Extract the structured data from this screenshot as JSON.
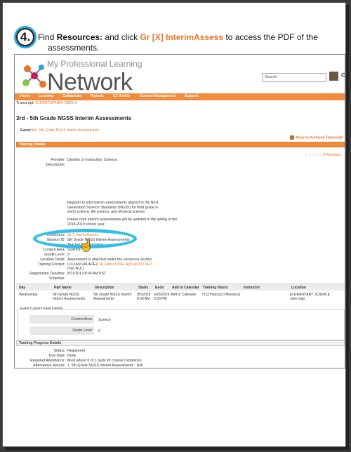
{
  "step": {
    "number": "4.",
    "text_before": "Find ",
    "resources_label": "Resources:",
    "text_middle": " and click ",
    "link_label": "Gr [X] InterimAssess",
    "text_after": " to access the PDF of the",
    "text_line2": "assessments."
  },
  "header": {
    "logo_small": "My Professional Learning",
    "logo_big": "Network",
    "search_placeholder": "Search",
    "colors": {
      "accent": "#f08c3c",
      "link": "#e8742a",
      "callout": "#2ec0e8",
      "step_ring": "#2aa6d6"
    }
  },
  "nav": [
    "Home",
    "Learning",
    "Collaborate",
    "Reports",
    "ILT Admin",
    "Content Management",
    "Support"
  ],
  "transcript": {
    "label": "Transcript:",
    "name": "CHRISTOPHER SIMS",
    "sep": ">"
  },
  "page_title": "3rd - 5th Grade NGSS Interim Assessments",
  "event": {
    "label": "Event:",
    "value": "3rd - 5th Grade NGSS Interim Assessments"
  },
  "archive_label": "Move to Archived Transcript",
  "training_details": {
    "header": "Training Details",
    "reviews": "0 Reviews",
    "stars": "☆☆☆☆☆",
    "provider_label": "Provider:",
    "provider_value": "Division of Instruction: Science",
    "description_label": "Description:",
    "desc1": "Register to pilot interim assessments aligned to the Next Generation Science Standards (NGSS) for third grade in earth science, life science, and physical science.",
    "desc2": "Please note interim assessments will be updated in the spring of the 2018-2019 school year.",
    "resources_label": "Resources:",
    "resources_value": "Gr 3 InterimAssess",
    "session_label": "Session ID:",
    "session_value": "5th Grade NGSS Interim Assessments",
    "teacher_value": "Teacher Development",
    "content_label": "Content Area:",
    "content_value": "Science",
    "grade_label": "Grade Level:",
    "grade_value": "3",
    "location_label": "Location Detail:",
    "location_value": "Assessment is attached under the resources section.",
    "contact_label": "Training Contact:",
    "contact_name": "LILLIAN VALADEZ",
    "contact_email": "LILLIAN.RODELA@LAUSD.NET",
    "contact_tel": "(Tel) NULL",
    "deadline_label": "Registration Deadline:",
    "deadline_value": "8/21/2019 8:00 AM PST",
    "schedule_label": "Schedule:"
  },
  "schedule_table": {
    "headers": [
      "Day",
      "Part Name",
      "Description",
      "Starts",
      "Ends",
      "Add to Calendar",
      "Training Hours",
      "Instructor",
      "Location"
    ],
    "row": {
      "day": "Wednesday",
      "part_name": "5th Grade NGSS Interim Assessments",
      "description": "5th Grade NGSS Interim Assessments",
      "starts": "9/5/2018 8:00 AM",
      "ends": "6/28/2019 5:00 PM",
      "add_to_calendar": "Add to Calendar",
      "training_hours": "7113 Hour(s) 0 Minute(s)",
      "instructor": "",
      "location": "ELEMENTARY SCIENCE",
      "view_map": "view map"
    }
  },
  "custom_fields": {
    "title": "Event Custom Field Details",
    "content_label": "Content Area:",
    "content_value": "Science",
    "grade_label": "Grade Level:",
    "grade_value": "3"
  },
  "progress": {
    "header": "Training Progress Details",
    "status_label": "Status:",
    "status_value": "Registered",
    "due_label": "Due Date:",
    "due_value": "None",
    "required_label": "Required Attendance:",
    "required_value": "Must attend 0 of 1 parts for course completion.",
    "record_label": "Attendance Record:",
    "record_value": "1. 5th Grade NGSS Interim Assessments : N/A"
  }
}
